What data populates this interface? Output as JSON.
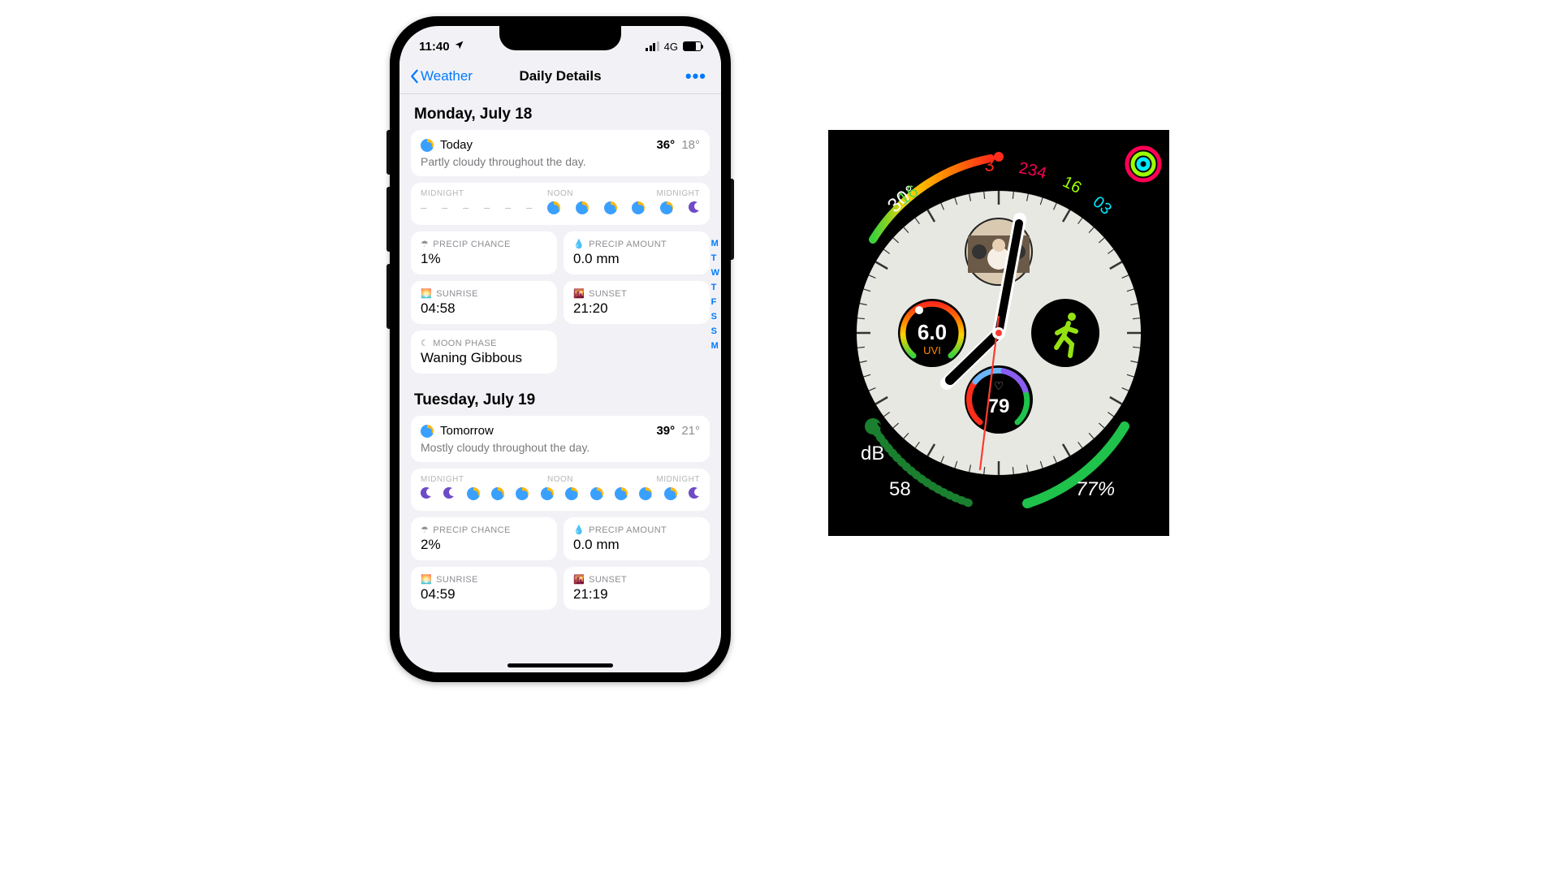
{
  "phone": {
    "status": {
      "time": "11:40",
      "network": "4G"
    },
    "nav": {
      "back": "Weather",
      "title": "Daily Details",
      "more": "•••"
    },
    "rail": [
      "M",
      "T",
      "W",
      "T",
      "F",
      "S",
      "S",
      "M"
    ],
    "labels": {
      "midnight": "MIDNIGHT",
      "noon": "NOON",
      "precip_chance": "PRECIP CHANCE",
      "precip_amount": "PRECIP AMOUNT",
      "sunrise": "SUNRISE",
      "sunset": "SUNSET",
      "moon": "MOON PHASE"
    },
    "days": [
      {
        "header": "Monday, July 18",
        "name": "Today",
        "hi": "36°",
        "lo": "18°",
        "desc": "Partly cloudy throughout the day.",
        "timeline": [
          "–",
          "–",
          "–",
          "–",
          "–",
          "–",
          "pc",
          "pc",
          "pc",
          "pc",
          "pc",
          "moon"
        ],
        "precip_chance": "1%",
        "precip_amount": "0.0 mm",
        "sunrise": "04:58",
        "sunset": "21:20",
        "moon_phase": "Waning Gibbous"
      },
      {
        "header": "Tuesday, July 19",
        "name": "Tomorrow",
        "hi": "39°",
        "lo": "21°",
        "desc": "Mostly cloudy throughout the day.",
        "timeline": [
          "moon",
          "moon",
          "pc",
          "pc",
          "pc",
          "pc",
          "pc",
          "pc",
          "pc",
          "pc",
          "pc",
          "moon"
        ],
        "precip_chance": "2%",
        "precip_amount": "0.0 mm",
        "sunrise": "04:59",
        "sunset": "21:19"
      }
    ]
  },
  "watch": {
    "temp_start": "30°",
    "temp_end": "37",
    "activity": {
      "move": "234",
      "exercise": "16",
      "stand": "03"
    },
    "temp_scale_min": "16",
    "uvi_value": "6.0",
    "uvi_label": "UVI",
    "heart_rate": "79",
    "noise_db": "58",
    "noise_unit": "dB",
    "battery": "77%"
  }
}
